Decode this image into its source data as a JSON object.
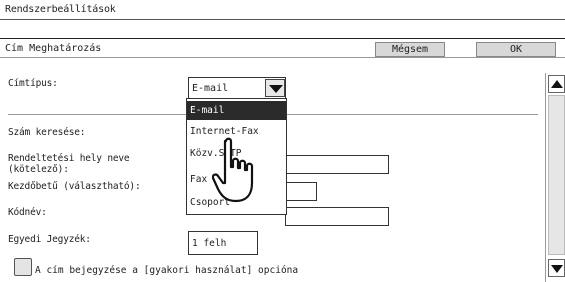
{
  "window": {
    "title": "Rendszerbeállítások"
  },
  "header": {
    "title": "Cím Meghatározás",
    "cancel_label": "Mégsem",
    "ok_label": "OK"
  },
  "form": {
    "address_type": {
      "label": "Címtípus:",
      "value": "E-mail"
    },
    "number_search": {
      "label": "Szám keresése:"
    },
    "dest_name": {
      "label": "Rendeltetési hely neve\n(kötelező):",
      "value": ""
    },
    "initial": {
      "label": "Kezdőbetű (választható):",
      "value": ""
    },
    "code_name": {
      "label": "Kódnév:",
      "value": ""
    },
    "custom_note": {
      "label": "Egyedi Jegyzék:",
      "value": "1 felh"
    }
  },
  "dropdown": {
    "options": [
      "E-mail",
      "Internet-Fax",
      "Közv.SMTP",
      "Fax",
      "Csoport"
    ],
    "selected": "E-mail"
  },
  "checkbox": {
    "label": "A cím bejegyzése a [gyakori használat] opcióna"
  },
  "colors": {
    "selected_bg": "#2a2a2a",
    "button_bg": "#d8d8d8"
  }
}
